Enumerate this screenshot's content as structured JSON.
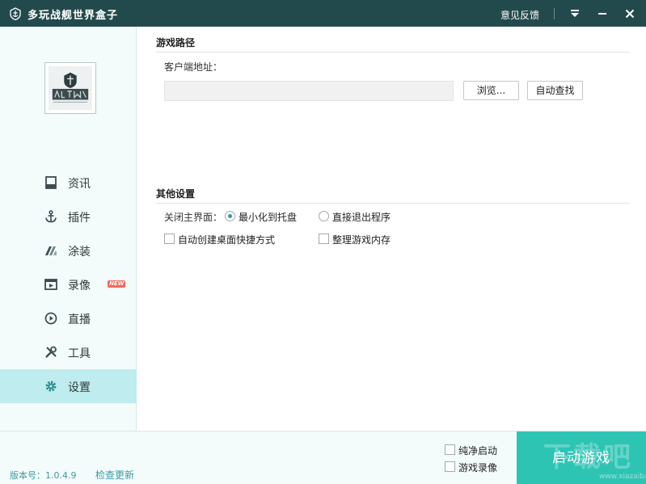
{
  "window": {
    "title": "多玩战舰世界盒子",
    "feedback_label": "意见反馈"
  },
  "sidebar": {
    "items": [
      {
        "label": "资讯",
        "icon": "news-icon"
      },
      {
        "label": "插件",
        "icon": "anchor-icon"
      },
      {
        "label": "涂装",
        "icon": "paint-icon"
      },
      {
        "label": "录像",
        "icon": "video-icon",
        "badge": "NEW"
      },
      {
        "label": "直播",
        "icon": "play-icon"
      },
      {
        "label": "工具",
        "icon": "tools-icon"
      },
      {
        "label": "设置",
        "icon": "gear-icon",
        "active": true
      }
    ]
  },
  "game_path": {
    "title": "游戏路径",
    "client_label": "客户端地址：",
    "path_value": "",
    "browse_label": "浏览...",
    "auto_find_label": "自动查找"
  },
  "other_settings": {
    "title": "其他设置",
    "close_label": "关闭主界面：",
    "minimize_label": "最小化到托盘",
    "exit_label": "直接退出程序",
    "shortcut_label": "自动创建桌面快捷方式",
    "memory_label": "整理游戏内存",
    "selected_close_option": "minimize"
  },
  "bottom": {
    "version": "版本号：1.0.4.9",
    "check_update": "检查更新",
    "pure_launch": "纯净启动",
    "game_record": "游戏录像",
    "launch_button": "启动游戏",
    "watermark": "下载吧",
    "watermark_url": "www.xiazaiba.com"
  },
  "colors": {
    "titlebar": "#224a4d",
    "accent": "#2ec4b4",
    "active_nav": "#bfecee",
    "link": "#3d9ba0"
  }
}
